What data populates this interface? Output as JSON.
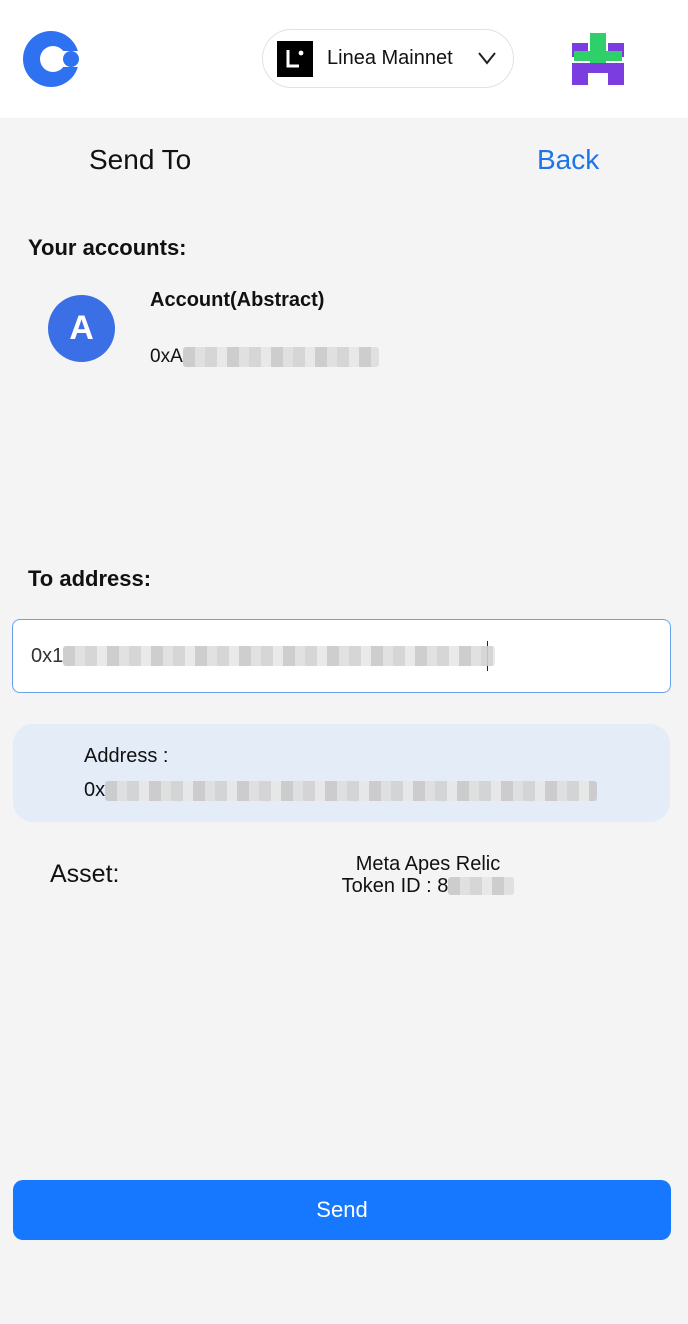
{
  "header": {
    "app_logo": "app-logo-icon",
    "network": {
      "name": "Linea Mainnet",
      "icon": "linea-icon"
    },
    "profile_logo": "profile-logo-icon"
  },
  "page": {
    "title": "Send To",
    "back_label": "Back"
  },
  "accounts": {
    "section_label": "Your accounts:",
    "items": [
      {
        "avatar_letter": "A",
        "name": "Account(Abstract)",
        "address_prefix": "0xA"
      }
    ]
  },
  "to_address": {
    "section_label": "To address:",
    "input_value_prefix": "0x1"
  },
  "address_card": {
    "label": "Address :",
    "value_prefix": "0x"
  },
  "asset": {
    "label": "Asset:",
    "name": "Meta Apes Relic",
    "token_id_label": "Token ID : 8"
  },
  "actions": {
    "send_label": "Send"
  },
  "colors": {
    "accent": "#1677ff",
    "link": "#1f74e8",
    "avatar": "#3b6fe6",
    "card_bg": "#e3ecf7"
  }
}
